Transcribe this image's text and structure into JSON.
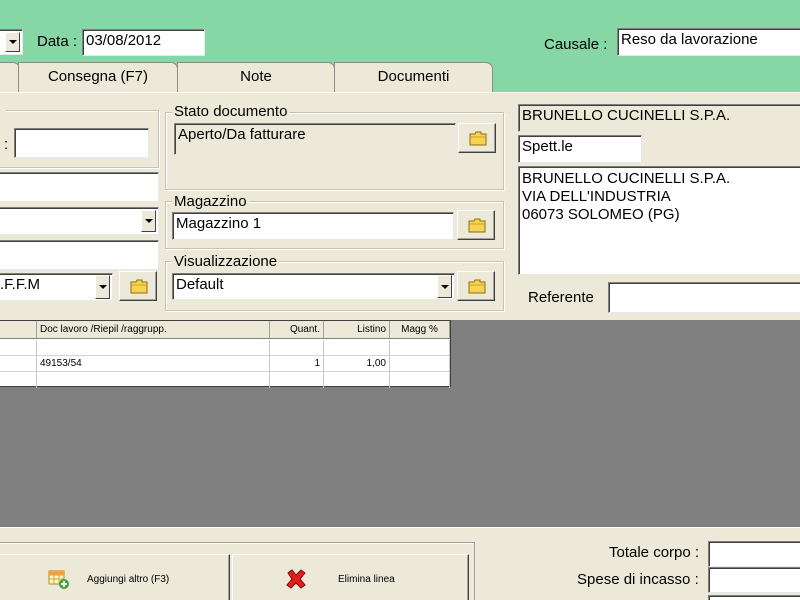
{
  "header": {
    "data_label": "Data :",
    "data_value": "03/08/2012",
    "causale_label": "Causale :",
    "causale_value": "Reso da lavorazione"
  },
  "tabs": [
    {
      "label": "Consegna (F7)"
    },
    {
      "label": "Note"
    },
    {
      "label": "Documenti"
    }
  ],
  "left_panel": {
    "colon_label": ":",
    "dropdown_value": ".F.F.M"
  },
  "stato": {
    "title": "Stato documento",
    "value": "Aperto/Da fatturare"
  },
  "magazzino": {
    "title": "Magazzino",
    "value": "Magazzino 1"
  },
  "visualizzazione": {
    "title": "Visualizzazione",
    "value": "Default"
  },
  "customer": {
    "name": "BRUNELLO CUCINELLI S.P.A.",
    "salutation": "Spett.le",
    "address_lines": [
      "BRUNELLO CUCINELLI S.P.A.",
      "VIA DELL'INDUSTRIA",
      "06073 SOLOMEO  (PG)"
    ],
    "referente_label": "Referente"
  },
  "grid": {
    "columns": [
      "Doc lavoro /Riepil /raggrupp.",
      "Quant.",
      "Listino",
      "Magg %"
    ],
    "rows": [
      {
        "doc": "",
        "quant": "",
        "listino": "",
        "magg": ""
      },
      {
        "doc": "49153/54",
        "quant": "1",
        "listino": "1,00",
        "magg": ""
      }
    ]
  },
  "buttons": {
    "aggiungi": "Aggiungi altro (F3)",
    "elimina": "Elimina linea"
  },
  "totals": {
    "totale_corpo": "Totale corpo :",
    "spese_incasso": "Spese di incasso :"
  },
  "colors": {
    "header_bg": "#86d6a6",
    "panel_bg": "#ece9d8",
    "grid_area": "#808080"
  }
}
